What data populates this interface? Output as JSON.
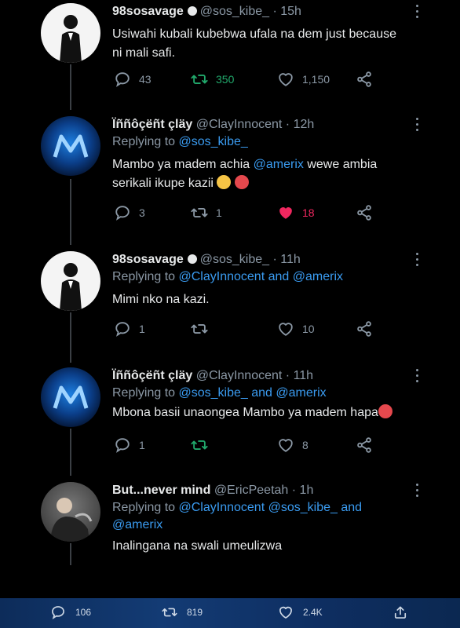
{
  "tweets": [
    {
      "name": "98sosavage",
      "handle": "@sos_kibe_",
      "time": "15h",
      "replying": null,
      "text_lines": [
        "Usiwahi kubali kubebwa ufala na dem just because",
        "ni mali safi."
      ],
      "replies": "43",
      "retweets": "350",
      "likes": "1,150",
      "retweet_active": true,
      "like_active": false
    },
    {
      "name": "Ïññôçëñt çläy",
      "handle": "@ClayInnocent",
      "time": "12h",
      "replying": {
        "prefix": "Replying to",
        "links": [
          "@sos_kibe_"
        ]
      },
      "text_lines": [
        "Mambo ya madem achia ",
        "@amerix",
        " wewe ambia",
        "serikali ikupe kazii"
      ],
      "replies": "3",
      "retweets": "1",
      "likes": "18",
      "retweet_active": false,
      "like_active": true
    },
    {
      "name": "98sosavage",
      "handle": "@sos_kibe_",
      "time": "11h",
      "replying": {
        "prefix": "Replying to",
        "links": [
          "@ClayInnocent",
          "and",
          "@amerix"
        ]
      },
      "text_lines": [
        "Mimi nko na kazi."
      ],
      "replies": "1",
      "retweets": "",
      "likes": "10",
      "retweet_active": false,
      "like_active": false
    },
    {
      "name": "Ïññôçëñt çläy",
      "handle": "@ClayInnocent",
      "time": "11h",
      "replying": {
        "prefix": "Replying to",
        "links": [
          "@sos_kibe_",
          "and",
          "@amerix"
        ]
      },
      "text_lines": [
        "Mbona basii unaongea Mambo ya madem hapa"
      ],
      "replies": "1",
      "retweets": "",
      "likes": "8",
      "retweet_active": true,
      "like_active": false
    },
    {
      "name": "But...never mind",
      "handle": "@EricPeetah",
      "time": "1h",
      "replying": {
        "prefix": "Replying to",
        "links": [
          "@ClayInnocent",
          "@sos_kibe_",
          "and",
          "@amerix"
        ]
      },
      "text_lines": [
        "Inalingana na swali umeulizwa"
      ]
    }
  ],
  "bottom_bar": {
    "replies": "106",
    "retweets": "819",
    "likes": "2.4K"
  },
  "colors": {
    "background": "#000000",
    "link": "#3a9bf0",
    "retweet_active": "#21a86b",
    "like_active": "#f0275f",
    "muted": "#8b98a5"
  },
  "icons": [
    "reply-icon",
    "retweet-icon",
    "like-icon",
    "share-icon",
    "more-icon",
    "verified-icon"
  ]
}
